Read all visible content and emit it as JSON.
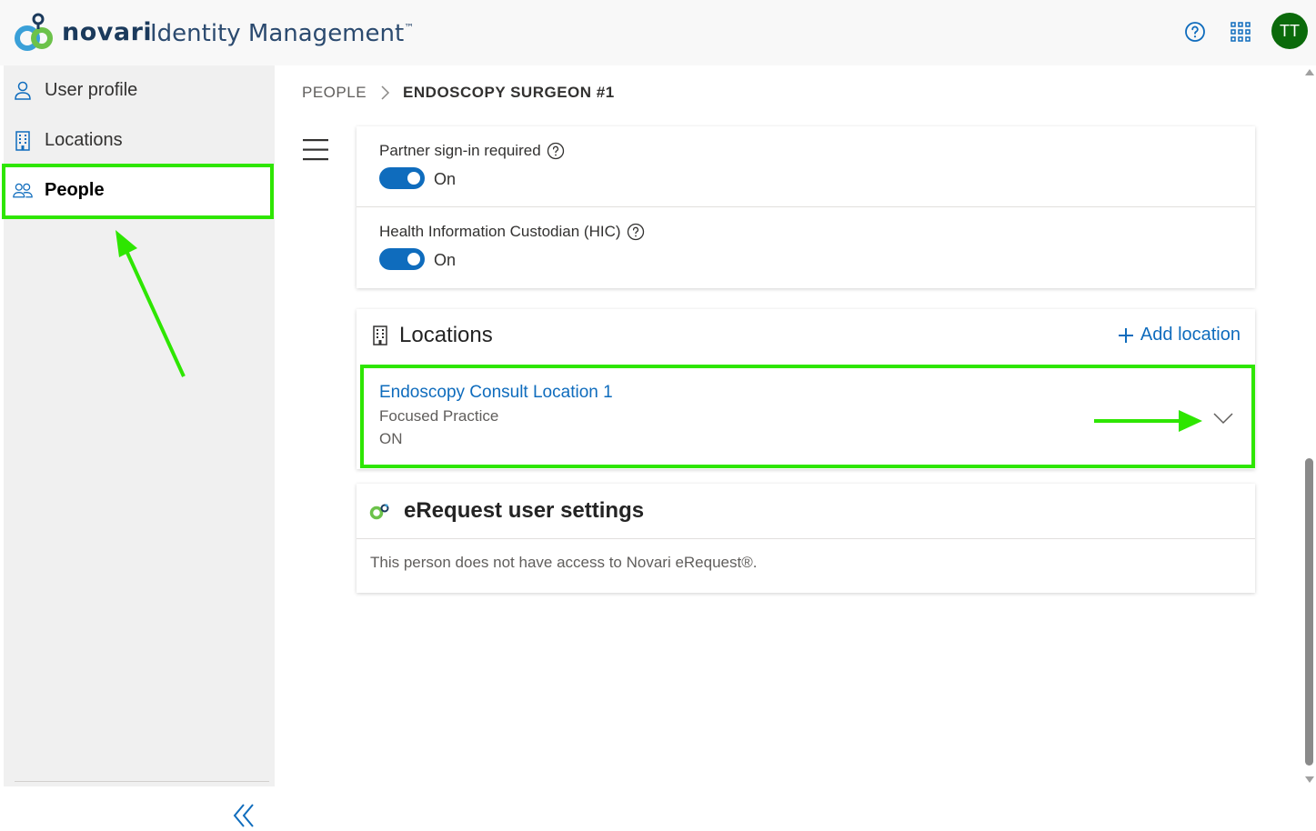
{
  "header": {
    "brand": "novari",
    "app_title": "Identity Management",
    "trademark": "™",
    "avatar_initials": "TT",
    "avatar_color": "#0b6a0b",
    "icons": [
      "novari-logo-icon",
      "help-icon",
      "app-launcher-icon"
    ]
  },
  "sidebar": {
    "items": [
      {
        "label": "User profile",
        "icon": "person-icon",
        "active": false
      },
      {
        "label": "Locations",
        "icon": "building-icon",
        "active": false
      },
      {
        "label": "People",
        "icon": "people-icon",
        "active": true
      }
    ],
    "collapse_icon": "double-chevron-left-icon"
  },
  "breadcrumb": {
    "root": "PEOPLE",
    "current": "ENDOSCOPY SURGEON #1"
  },
  "settings": {
    "rows": [
      {
        "label": "Partner sign-in required",
        "value": "On",
        "enabled": true
      },
      {
        "label": "Health Information Custodian (HIC)",
        "value": "On",
        "enabled": true
      }
    ]
  },
  "locations": {
    "title": "Locations",
    "add_label": "Add location",
    "items": [
      {
        "name": "Endoscopy Consult Location 1",
        "type": "Focused Practice",
        "state": "ON"
      }
    ]
  },
  "erequest": {
    "title": "eRequest user settings",
    "message": "This person does not have access to Novari eRequest®."
  },
  "colors": {
    "accent": "#0f6cbd",
    "highlight": "#2ee600",
    "sidebar_bg": "#f0f0f0"
  }
}
